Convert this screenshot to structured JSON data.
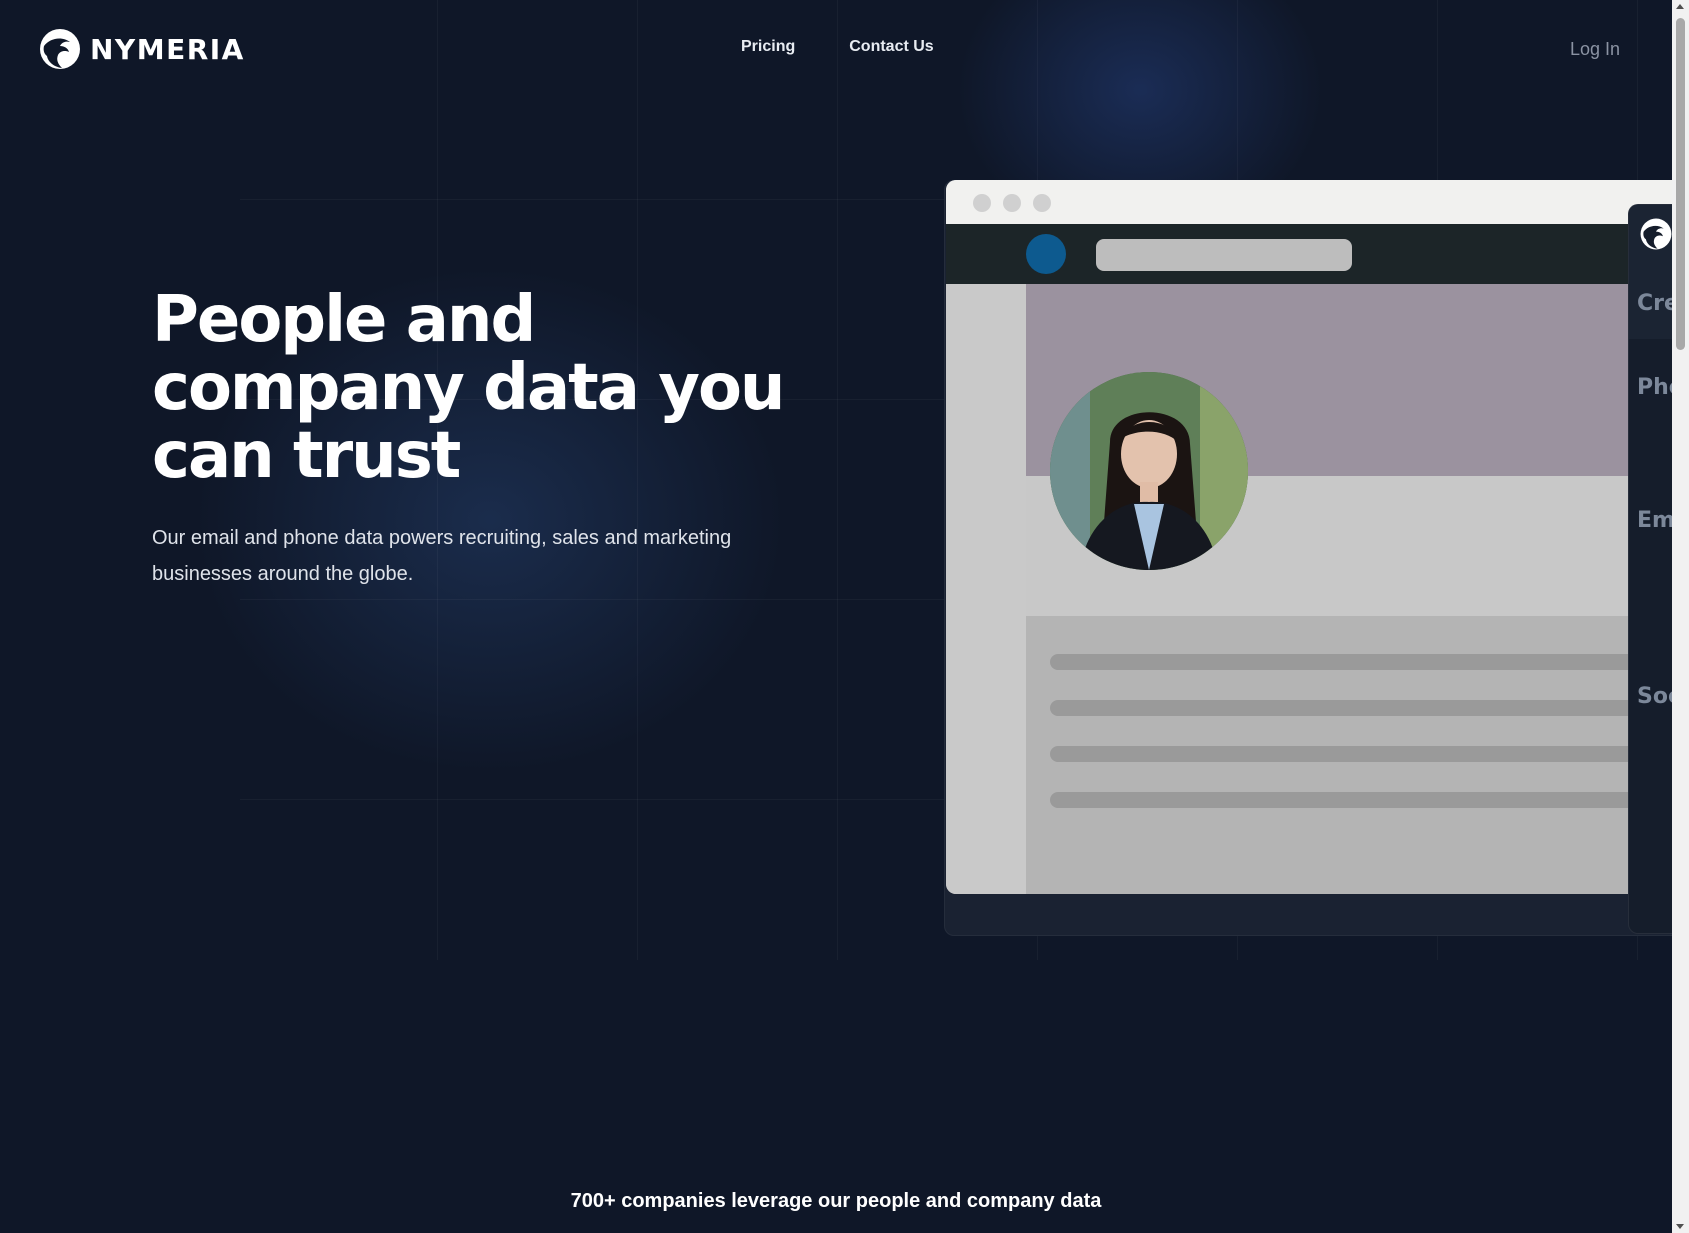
{
  "header": {
    "brand": "NYMERIA",
    "nav": [
      {
        "label": "Pricing"
      },
      {
        "label": "Contact Us"
      }
    ],
    "login_label": "Log In"
  },
  "hero": {
    "title": "People and company data you can trust",
    "subtitle": "Our email and phone data powers recruiting, sales and marketing businesses around the globe."
  },
  "mockup": {
    "side_panel_labels": [
      "Cre",
      "Pho",
      "Em",
      "Soc"
    ]
  },
  "trust": {
    "text": "700+ companies leverage our people and company data"
  },
  "colors": {
    "background": "#0f1728",
    "accent_dot": "#0d5a8f",
    "cover": "#9b929f"
  }
}
